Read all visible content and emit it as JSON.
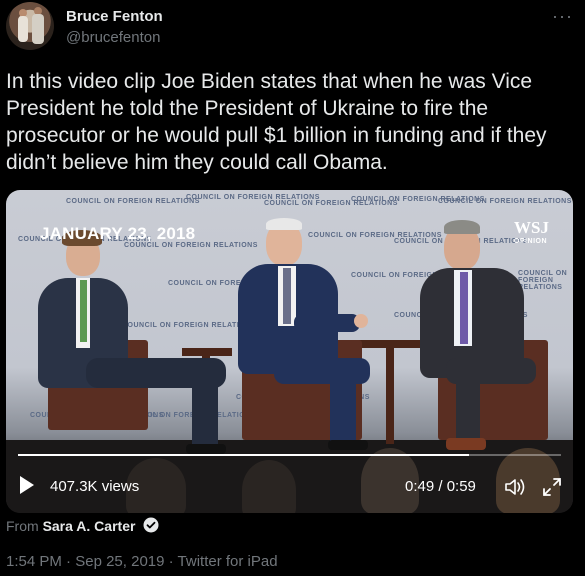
{
  "author": {
    "name": "Bruce Fenton",
    "handle": "@brucefenton"
  },
  "more_menu": "···",
  "tweet": {
    "text": "In this video clip Joe Biden states that when he was Vice President he told the President of Ukraine to fire the prosecutor or he would pull $1 billion in funding and if they didn’t believe him they could call Obama."
  },
  "video": {
    "overlay_date": "JANUARY 23, 2018",
    "watermark": "WSJ",
    "watermark_sub": "OPINION",
    "backdrop_text": "COUNCIL ON FOREIGN RELATIONS",
    "views": "407.3K views",
    "time": "0:49 / 0:59",
    "progress": 0.83
  },
  "source": {
    "prefix": "From ",
    "name": "Sara A. Carter"
  },
  "meta": {
    "time": "1:54 PM",
    "sep1": " · ",
    "date": "Sep 25, 2019",
    "sep2": " · ",
    "client": "Twitter for iPad"
  },
  "colors": {
    "background": "#000000",
    "text": "#e7e9ea",
    "muted": "#71767b"
  },
  "icons": [
    "avatar",
    "more-icon",
    "play-icon",
    "volume-icon",
    "fullscreen-icon",
    "verified-badge-icon"
  ]
}
